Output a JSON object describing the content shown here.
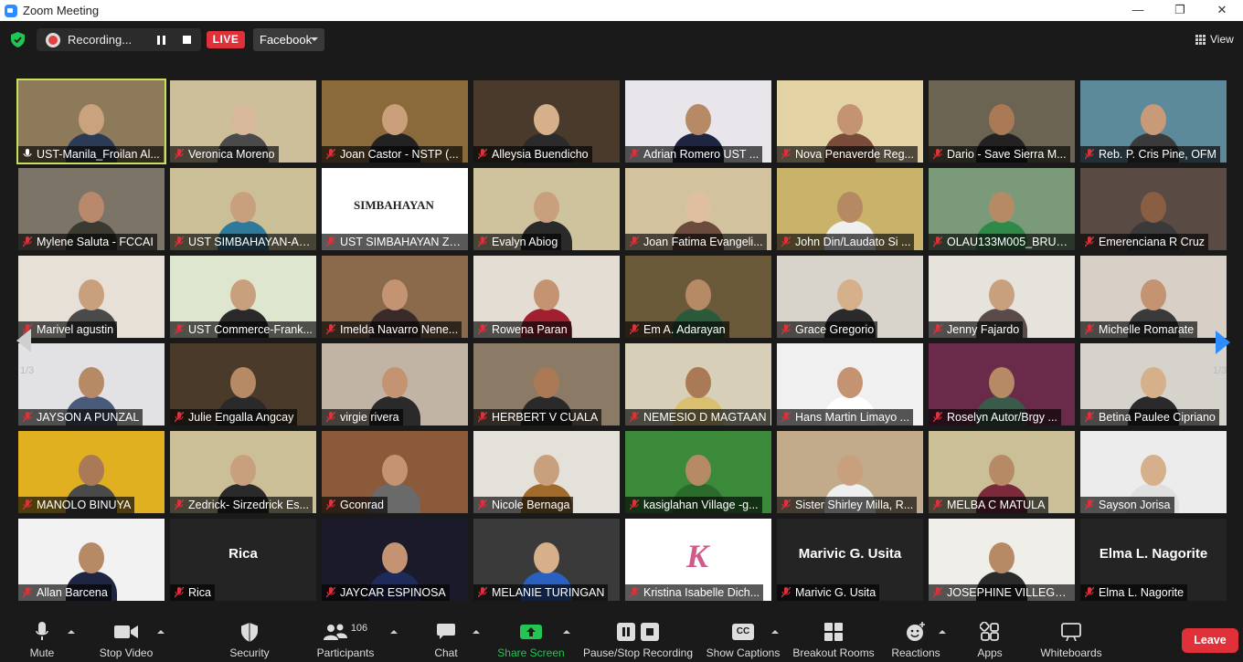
{
  "window": {
    "title": "Zoom Meeting",
    "minimize": "—",
    "restore": "❐",
    "close": "✕"
  },
  "topbar": {
    "recording_label": "Recording...",
    "live_label": "LIVE",
    "stream_target": "Facebook",
    "view_label": "View"
  },
  "pagination": {
    "left": "1/3",
    "right": "1/3"
  },
  "participants": [
    {
      "name": "UST-Manila_Froilan Al...",
      "bg": "#8c7a5a",
      "skin": "#c9a27e",
      "shirt": "#2b3a55",
      "active": true
    },
    {
      "name": "Veronica Moreno",
      "bg": "#cdbf9a",
      "skin": "#d8b89a",
      "shirt": "#4a4a4a"
    },
    {
      "name": "Joan Castor - NSTP (...",
      "bg": "#8a6a3a",
      "skin": "#c9a07a",
      "shirt": "#222222"
    },
    {
      "name": "Alleysia  Buendicho",
      "bg": "#4a3a2c",
      "skin": "#d6b08a",
      "shirt": "#2b2b2b"
    },
    {
      "name": "Adrian Romero UST ...",
      "bg": "#e8e6ea",
      "skin": "#b78a66",
      "shirt": "#1e2540"
    },
    {
      "name": "Nova Penaverde Reg...",
      "bg": "#e3d2a4",
      "skin": "#c49472",
      "shirt": "#7a4a3a"
    },
    {
      "name": "Dario - Save Sierra M...",
      "bg": "#6c6452",
      "skin": "#a97a55",
      "shirt": "#222222"
    },
    {
      "name": "Reb. P. Cris Pine, OFM",
      "bg": "#5d8a9a",
      "skin": "#c99a78",
      "shirt": "#3a3a3a"
    },
    {
      "name": "Mylene Saluta - FCCAI",
      "bg": "#7c7466",
      "skin": "#b8896a",
      "shirt": "#3a3a30"
    },
    {
      "name": "UST SIMBAHAYAN-Ab...",
      "bg": "#cbbf98",
      "skin": "#c9a07e",
      "shirt": "#2f7a9a"
    },
    {
      "name": "UST SIMBAHAYAN Zo...",
      "bg": "#ffffff",
      "skin": "#ffffff",
      "shirt": "#ffffff",
      "logo_text": "SIMBAHAYAN"
    },
    {
      "name": "Evalyn Abiog",
      "bg": "#cfc39e",
      "skin": "#c9a07e",
      "shirt": "#2a2a2a"
    },
    {
      "name": "Joan Fatima Evangeli...",
      "bg": "#d2c29e",
      "skin": "#e0bfa0",
      "shirt": "#6b4b3b"
    },
    {
      "name": "John Din/Laudato Si ...",
      "bg": "#c9b36a",
      "skin": "#b58a62",
      "shirt": "#efefef"
    },
    {
      "name": "OLAU133M005_BRUS...",
      "bg": "#7a9a7a",
      "skin": "#b78a66",
      "shirt": "#2f8a4a"
    },
    {
      "name": "Emerenciana R Cruz",
      "bg": "#5a4a44",
      "skin": "#8a5e42",
      "shirt": "#3a3a3a"
    },
    {
      "name": "Marivel agustin",
      "bg": "#e6e0d6",
      "skin": "#c9a07e",
      "shirt": "#4a4a4a"
    },
    {
      "name": "UST Commerce-Frank...",
      "bg": "#dfe6d0",
      "skin": "#c9a07e",
      "shirt": "#2a2a2a"
    },
    {
      "name": "Imelda Navarro Nene...",
      "bg": "#8a6a4a",
      "skin": "#c49472",
      "shirt": "#3a2a2a"
    },
    {
      "name": "Rowena Paran",
      "bg": "#e3ddd3",
      "skin": "#c49472",
      "shirt": "#a02030"
    },
    {
      "name": "Em A. Adarayan",
      "bg": "#6a5a3a",
      "skin": "#b78a66",
      "shirt": "#2a5a3a"
    },
    {
      "name": "Grace Gregorio",
      "bg": "#d8d4cc",
      "skin": "#d6b08a",
      "shirt": "#2a2a2a"
    },
    {
      "name": "Jenny Fajardo",
      "bg": "#e6e2dc",
      "skin": "#c9a07e",
      "shirt": "#5a4a4a"
    },
    {
      "name": "Michelle Romarate",
      "bg": "#d8d0c6",
      "skin": "#c49472",
      "shirt": "#3a3a3a"
    },
    {
      "name": "JAYSON A PUNZAL",
      "bg": "#e2e2e4",
      "skin": "#b78a66",
      "shirt": "#4a5a7a"
    },
    {
      "name": "Julie Engalla Angcay",
      "bg": "#4a3a2a",
      "skin": "#b78a66",
      "shirt": "#2a2a2a"
    },
    {
      "name": "virgie rivera",
      "bg": "#c2b4a4",
      "skin": "#c49472",
      "shirt": "#2a2a2a"
    },
    {
      "name": "HERBERT V CUALA",
      "bg": "#8a7a66",
      "skin": "#a97a55",
      "shirt": "#2a2a2a"
    },
    {
      "name": "NEMESIO D MAGTAAN",
      "bg": "#d8cfb8",
      "skin": "#a97a55",
      "shirt": "#d8c070"
    },
    {
      "name": "Hans Martin Limayo ...",
      "bg": "#f0f0f0",
      "skin": "#c49472",
      "shirt": "#ffffff"
    },
    {
      "name": "Roselyn Autor/Brgy  ...",
      "bg": "#6a2a4a",
      "skin": "#b78a66",
      "shirt": "#3a5a4a"
    },
    {
      "name": "Betina Paulee Cipriano",
      "bg": "#d6d2cc",
      "skin": "#d6b08a",
      "shirt": "#2a2a2a"
    },
    {
      "name": "MANOLO BINUYA",
      "bg": "#e0b020",
      "skin": "#a97a55",
      "shirt": "#4a4a4a"
    },
    {
      "name": "Zedrick- Sirzedrick Es...",
      "bg": "#cbbf98",
      "skin": "#c9a07e",
      "shirt": "#2a2a2a"
    },
    {
      "name": "Gconrad",
      "bg": "#8a5a3a",
      "skin": "#c49472",
      "shirt": "#6a6a6a"
    },
    {
      "name": "Nicole Bernaga",
      "bg": "#e4e0da",
      "skin": "#c9a07e",
      "shirt": "#a06a2a"
    },
    {
      "name": "kasiglahan Village -g...",
      "bg": "#3a8a3a",
      "skin": "#b78a66",
      "shirt": "#2a6a2a"
    },
    {
      "name": "Sister Shirley Milla, R...",
      "bg": "#c2ab8a",
      "skin": "#c9a07e",
      "shirt": "#efefef"
    },
    {
      "name": "MELBA C MATULA",
      "bg": "#cbbf98",
      "skin": "#b78a66",
      "shirt": "#7a2a3a"
    },
    {
      "name": "Sayson Jorisa",
      "bg": "#ececec",
      "skin": "#d6b08a",
      "shirt": "#e0e0e0"
    },
    {
      "name": "Allan Barcena",
      "bg": "#f2f2f2",
      "skin": "#b78a66",
      "shirt": "#1e2540"
    },
    {
      "name": "Rica",
      "bg": "#242424",
      "text_only": "Rica"
    },
    {
      "name": "JAYCAR ESPINOSA",
      "bg": "#1a1a2a",
      "skin": "#c49472",
      "shirt": "#1e2a5a"
    },
    {
      "name": "MELANIE TURINGAN",
      "bg": "#3a3a3a",
      "skin": "#d6b08a",
      "shirt": "#2a60c0"
    },
    {
      "name": "Kristina Isabelle Dich...",
      "bg": "#ffffff",
      "skin": "#ffffff",
      "shirt": "#ffffff",
      "logo_text": "K"
    },
    {
      "name": "Marivic G. Usita",
      "bg": "#242424",
      "text_only": "Marivic G. Usita"
    },
    {
      "name": "JOSEPHINE VILLEGAS...",
      "bg": "#f0eee8",
      "skin": "#b78a66",
      "shirt": "#2a2a2a"
    },
    {
      "name": "Elma L. Nagorite",
      "bg": "#242424",
      "text_only": "Elma L. Nagorite"
    }
  ],
  "toolbar": {
    "mute": "Mute",
    "stop_video": "Stop Video",
    "security": "Security",
    "participants": "Participants",
    "participant_count": "106",
    "chat": "Chat",
    "share_screen": "Share Screen",
    "pause_stop_recording": "Pause/Stop Recording",
    "show_captions": "Show Captions",
    "breakout_rooms": "Breakout Rooms",
    "reactions": "Reactions",
    "apps": "Apps",
    "whiteboards": "Whiteboards",
    "leave": "Leave",
    "cc_label": "CC"
  },
  "colors": {
    "accent": "#2d8cff",
    "share_green": "#23c552",
    "leave_red": "#e0303a",
    "live_red": "#e0303a",
    "active_speaker": "#c9e05a"
  }
}
